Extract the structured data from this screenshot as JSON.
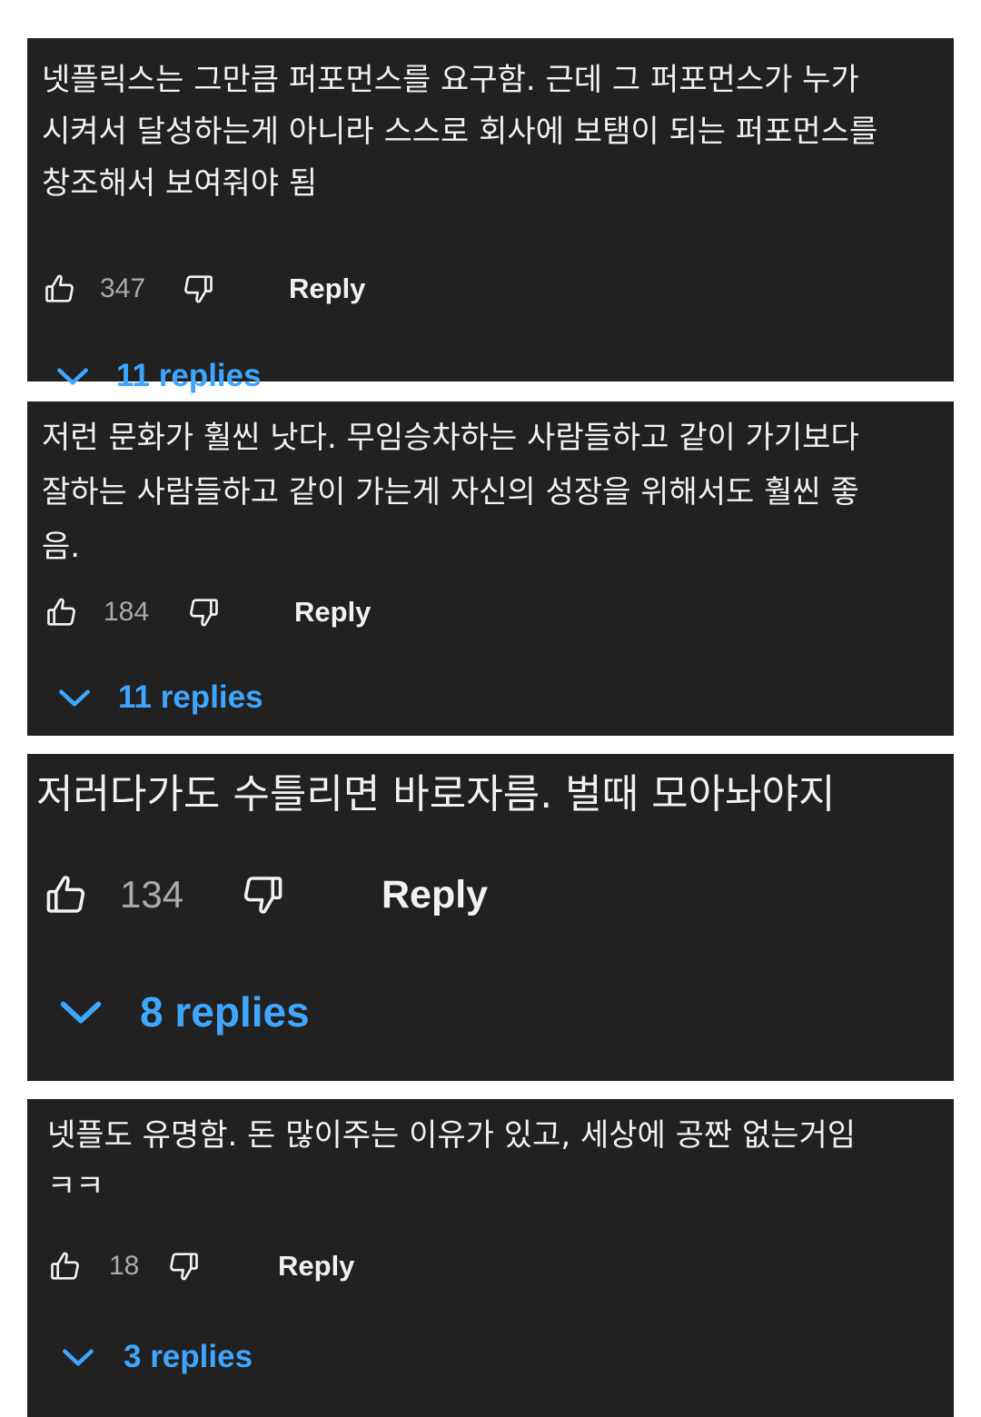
{
  "comments": [
    {
      "text": "넷플릭스는 그만큼 퍼포먼스를 요구함. 근데 그 퍼포먼스가 누가\n시켜서 달성하는게 아니라 스스로 회사에 보탬이 되는 퍼포먼스를\n창조해서 보여줘야 됨",
      "likes": "347",
      "reply_label": "Reply",
      "replies_label": "11 replies",
      "icons": [
        "thumbs-up-icon",
        "thumbs-down-icon",
        "chevron-down-icon"
      ]
    },
    {
      "text": "저런 문화가 훨씬 낫다. 무임승차하는 사람들하고 같이 가기보다\n잘하는 사람들하고 같이 가는게 자신의 성장을 위해서도 훨씬 좋\n음.",
      "likes": "184",
      "reply_label": "Reply",
      "replies_label": "11 replies",
      "icons": [
        "thumbs-up-icon",
        "thumbs-down-icon",
        "chevron-down-icon"
      ]
    },
    {
      "text": "저러다가도 수틀리면 바로자름.  벌때 모아놔야지",
      "likes": "134",
      "reply_label": "Reply",
      "replies_label": "8 replies",
      "icons": [
        "thumbs-up-icon",
        "thumbs-down-icon",
        "chevron-down-icon"
      ]
    },
    {
      "text": "넷플도 유명함. 돈 많이주는 이유가 있고, 세상에 공짠 없는거임\nㅋㅋ",
      "likes": "18",
      "reply_label": "Reply",
      "replies_label": "3 replies",
      "icons": [
        "thumbs-up-icon",
        "thumbs-down-icon",
        "chevron-down-icon"
      ]
    }
  ],
  "colors": {
    "card_background": "#212121",
    "text_primary": "#f1f1f1",
    "text_secondary": "#aaaaaa",
    "accent_link": "#3ea6ff",
    "page_background": "#ffffff"
  }
}
